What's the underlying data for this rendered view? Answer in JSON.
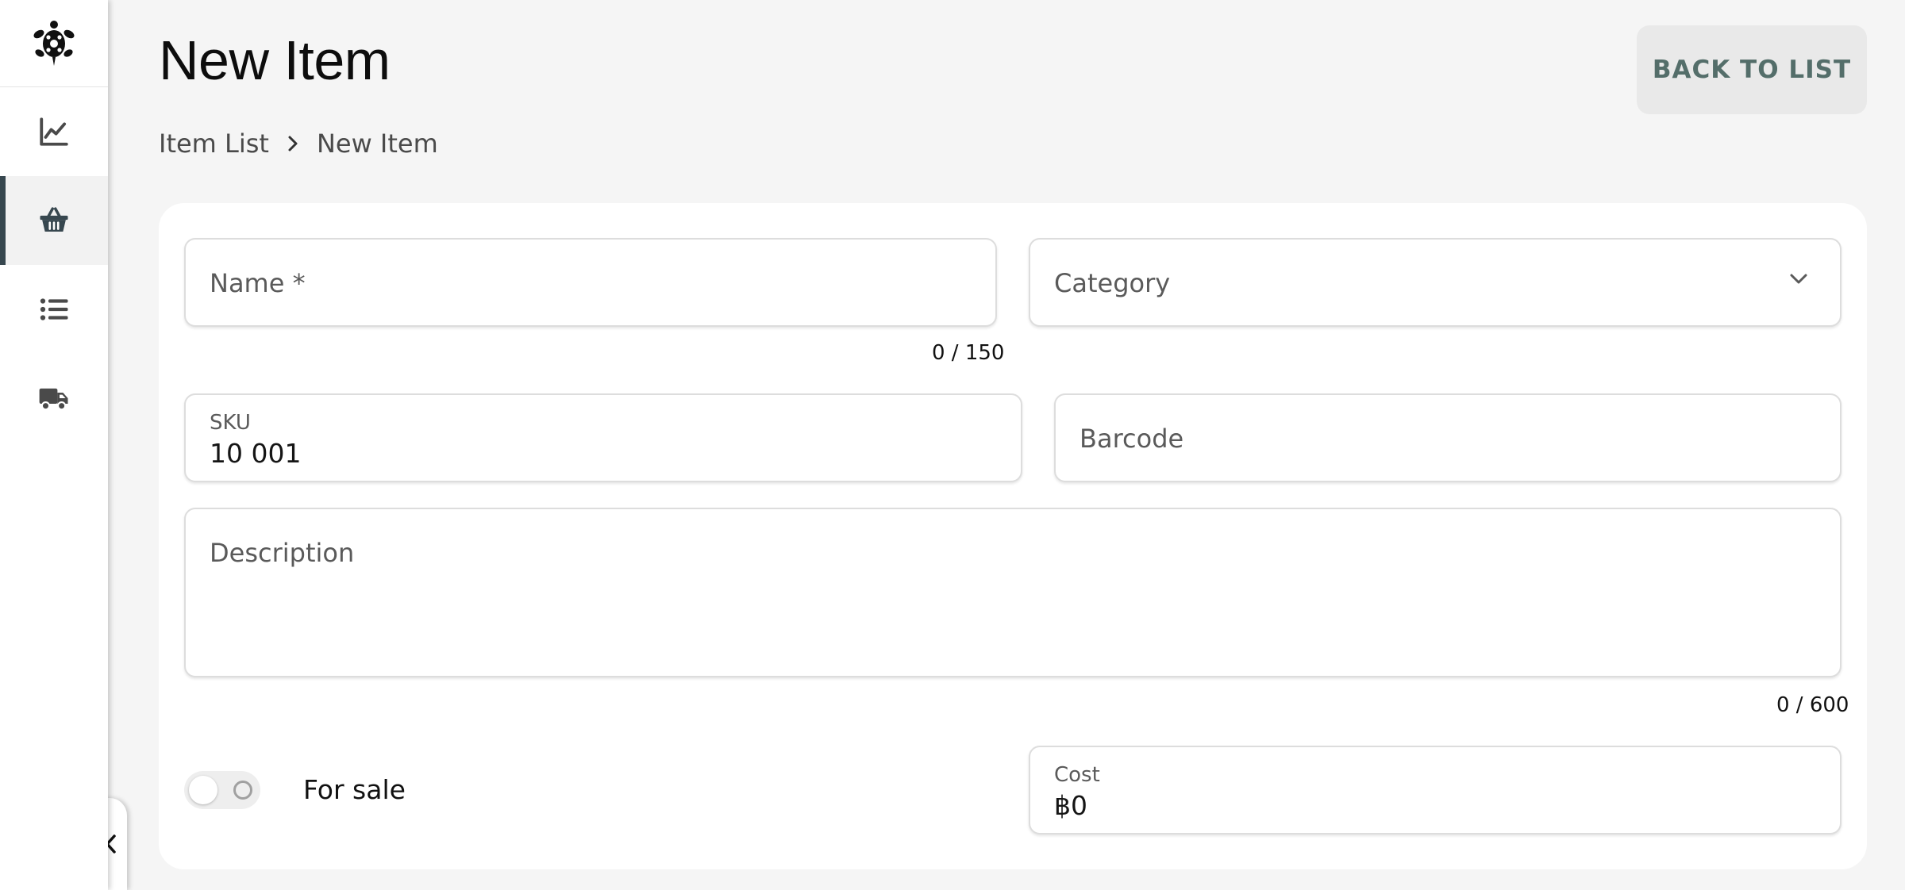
{
  "page": {
    "title": "New Item",
    "back_label": "BACK TO LIST"
  },
  "breadcrumb": {
    "items": [
      "Item List",
      "New Item"
    ]
  },
  "sidebar": {
    "items": [
      {
        "icon": "chart-line-icon",
        "active": false
      },
      {
        "icon": "basket-icon",
        "active": true
      },
      {
        "icon": "list-icon",
        "active": false
      },
      {
        "icon": "truck-icon",
        "active": false
      }
    ],
    "accent": "#37474f"
  },
  "form": {
    "name": {
      "placeholder": "Name *",
      "counter": "0 / 150"
    },
    "category": {
      "placeholder": "Category"
    },
    "sku": {
      "label": "SKU",
      "value": "10 001"
    },
    "barcode": {
      "placeholder": "Barcode"
    },
    "description": {
      "placeholder": "Description",
      "counter": "0 / 600"
    },
    "for_sale": {
      "label": "For sale",
      "enabled": false
    },
    "cost": {
      "label": "Cost",
      "value": "฿0"
    }
  }
}
